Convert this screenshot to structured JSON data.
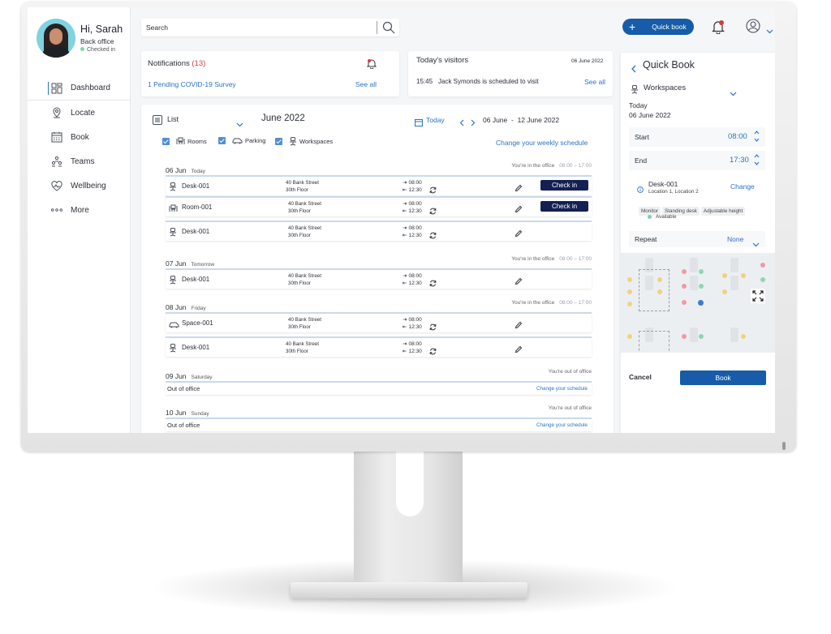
{
  "user": {
    "greeting": "Hi, Sarah",
    "office": "Back office",
    "status": "Checked in"
  },
  "nav": {
    "items": [
      {
        "label": "Dashboard",
        "icon": "dashboard-icon"
      },
      {
        "label": "Locate",
        "icon": "location-pin-icon"
      },
      {
        "label": "Book",
        "icon": "calendar-icon"
      },
      {
        "label": "Teams",
        "icon": "teams-icon"
      },
      {
        "label": "Wellbeing",
        "icon": "heart-icon"
      },
      {
        "label": "More",
        "icon": "more-dots-icon"
      }
    ]
  },
  "search": {
    "placeholder": "Search"
  },
  "topbar": {
    "quick_book": "Quick book"
  },
  "notifications": {
    "title": "Notifications",
    "count": "(13)",
    "item": "1 Pending COVID-19 Survey",
    "see_all": "See all"
  },
  "visitors": {
    "title": "Today's visitors",
    "date": "06 June 2022",
    "time": "15:45",
    "text": "Jack Symonds is scheduled to visit",
    "see_all": "See all"
  },
  "schedule": {
    "view": "List",
    "month": "June 2022",
    "today": "Today",
    "range_start": "06 June",
    "range_sep": "-",
    "range_end": "12 June  2022",
    "filters": [
      "Rooms",
      "Parking",
      "Workspaces"
    ],
    "change_weekly": "Change your weekly schedule",
    "days": [
      {
        "date": "06 Jun",
        "day": "Today",
        "status": "You're in the office",
        "hours": "08:00 – 17:00"
      },
      {
        "date": "07 Jun",
        "day": "Tomorrow",
        "status": "You're in the office",
        "hours": "08:00 – 17:00"
      },
      {
        "date": "08 Jun",
        "day": "Friday",
        "status": "You're in the office",
        "hours": "08:00 – 17:00"
      },
      {
        "date": "09 Jun",
        "day": "Saturday",
        "status": "You're out of office"
      },
      {
        "date": "10 Jun",
        "day": "Sunday",
        "status": "You're out of office"
      }
    ],
    "bookings": [
      {
        "name": "Desk-001",
        "street": "40 Bank Street",
        "floor": "30th Floor",
        "in": "08:00",
        "out": "12:30",
        "action": "Check in"
      },
      {
        "name": "Room-001",
        "street": "40 Bank Street",
        "floor": "30th Floor",
        "in": "08:00",
        "out": "12:30",
        "action": "Check in"
      },
      {
        "name": "Desk-001",
        "street": "40 Bank Street",
        "floor": "30th Floor",
        "in": "08:00",
        "out": "12:30"
      },
      {
        "name": "Desk-001",
        "street": "40 Bank Street",
        "floor": "30th Floor",
        "in": "08:00",
        "out": "12:30"
      },
      {
        "name": "Space-001",
        "street": "40 Bank Street",
        "floor": "30th Floor",
        "in": "08:00",
        "out": "12:30"
      },
      {
        "name": "Desk-001",
        "street": "40 Bank Street",
        "floor": "30th Floor",
        "in": "08:00",
        "out": "12:30"
      }
    ],
    "out_of_office": "Out of office",
    "change_schedule": "Change your schedule"
  },
  "quick_book": {
    "title": "Quick Book",
    "type": "Workspaces",
    "when": "Today",
    "date": "06 June 2022",
    "start_label": "Start",
    "start_value": "08:00",
    "end_label": "End",
    "end_value": "17:30",
    "desk": "Desk-001",
    "location": "Location 1, Location 2",
    "change": "Change",
    "tags": [
      "Monitor",
      "Standing desk",
      "Adjustable height"
    ],
    "availability": "Available",
    "repeat_label": "Repeat",
    "repeat_value": "None",
    "cancel": "Cancel",
    "book": "Book"
  },
  "colors": {
    "primary": "#165ca8",
    "checkin": "#141f52",
    "link": "#2a72c8",
    "alert": "#d43b3b",
    "available": "#7ed3a8"
  }
}
